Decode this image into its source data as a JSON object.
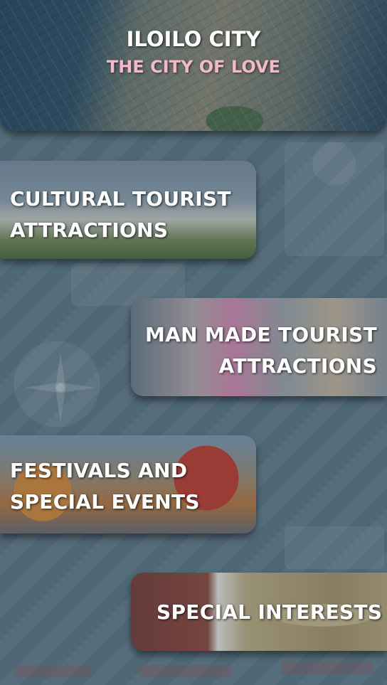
{
  "header": {
    "title": "ILOILO CITY",
    "subtitle": "THE CITY OF LOVE",
    "subtitle_color": "#f4b9c6"
  },
  "categories": [
    {
      "label_line1": "CULTURAL TOURIST",
      "label_line2": "ATTRACTIONS"
    },
    {
      "label_line1": "MAN MADE TOURIST",
      "label_line2": "ATTRACTIONS"
    },
    {
      "label_line1": "FESTIVALS AND",
      "label_line2": "SPECIAL EVENTS"
    },
    {
      "label_line1": "SPECIAL INTERESTS"
    }
  ],
  "background_color": "#4f6876"
}
